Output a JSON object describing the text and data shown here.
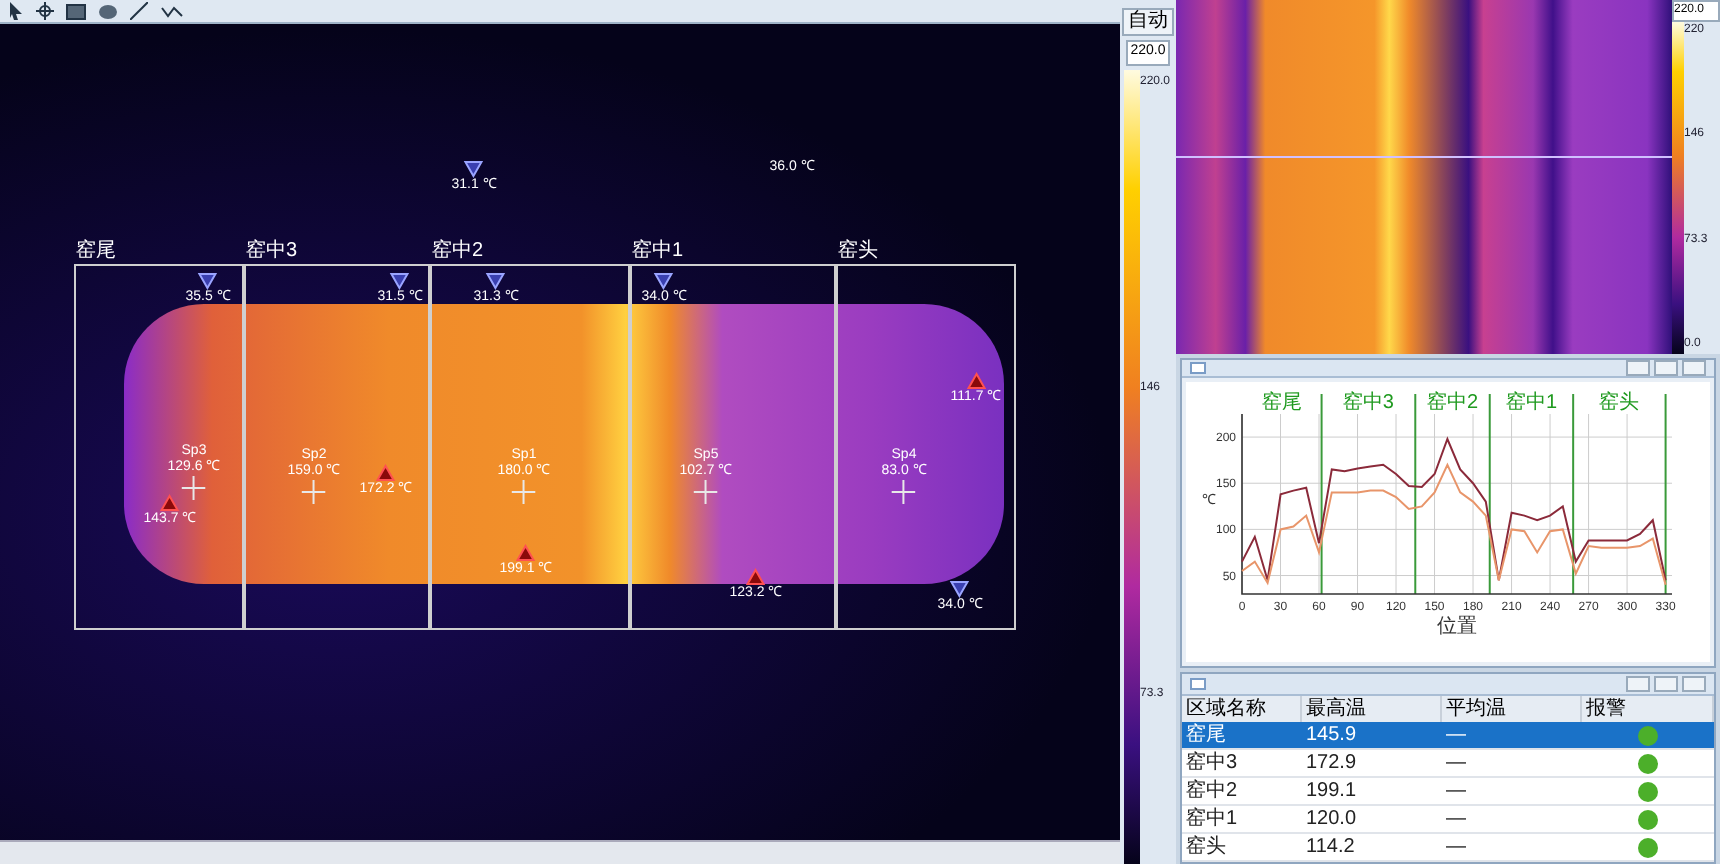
{
  "thermal_view": {
    "zones": [
      {
        "label": "窑尾"
      },
      {
        "label": "窑中3"
      },
      {
        "label": "窑中2"
      },
      {
        "label": "窑中1"
      },
      {
        "label": "窑头"
      }
    ],
    "markers": [
      {
        "kind": "min",
        "reading": "31.1 ℃"
      },
      {
        "kind": "text",
        "reading": "36.0 ℃"
      },
      {
        "kind": "min",
        "reading": "35.5 ℃"
      },
      {
        "kind": "min",
        "reading": "31.5 ℃"
      },
      {
        "kind": "min",
        "reading": "31.3 ℃"
      },
      {
        "kind": "min",
        "reading": "34.0 ℃"
      },
      {
        "kind": "spot",
        "name": "Sp3",
        "reading": "129.6 ℃"
      },
      {
        "kind": "max",
        "reading": "143.7 ℃"
      },
      {
        "kind": "spot",
        "name": "Sp2",
        "reading": "159.0 ℃"
      },
      {
        "kind": "max",
        "reading": "172.2 ℃"
      },
      {
        "kind": "spot",
        "name": "Sp1",
        "reading": "180.0 ℃"
      },
      {
        "kind": "max",
        "reading": "199.1 ℃"
      },
      {
        "kind": "spot",
        "name": "Sp5",
        "reading": "102.7 ℃"
      },
      {
        "kind": "max",
        "reading": "123.2 ℃"
      },
      {
        "kind": "spot",
        "name": "Sp4",
        "reading": "83.0 ℃"
      },
      {
        "kind": "max",
        "reading": "111.7 ℃"
      },
      {
        "kind": "min",
        "reading": "34.0 ℃"
      }
    ]
  },
  "palette_scale": {
    "mode_button": "自动",
    "range_max": "220.0",
    "ticks": [
      "220.0",
      "146",
      "73.3"
    ]
  },
  "strip_scale": {
    "range_max": "220.0",
    "ticks": [
      "220",
      "146",
      "73.3",
      "0.0"
    ]
  },
  "profile_chart": {
    "sections": [
      "窑尾",
      "窑中3",
      "窑中2",
      "窑中1",
      "窑头"
    ],
    "chart_data": {
      "type": "line",
      "grid": true,
      "xlabel": "位置",
      "ylabel": "℃",
      "x": [
        0,
        10,
        20,
        30,
        40,
        50,
        60,
        70,
        80,
        90,
        100,
        110,
        120,
        130,
        140,
        150,
        160,
        170,
        180,
        190,
        200,
        210,
        220,
        230,
        240,
        250,
        260,
        270,
        280,
        290,
        300,
        310,
        320,
        330
      ],
      "xlim": [
        0,
        335
      ],
      "ylim": [
        30,
        225
      ],
      "xticks": [
        0,
        30,
        60,
        90,
        120,
        150,
        180,
        210,
        240,
        270,
        300,
        330
      ],
      "yticks": [
        50,
        100,
        150,
        200
      ],
      "series": [
        {
          "color": "#8b2a3a",
          "values": [
            65,
            92,
            45,
            138,
            142,
            145,
            85,
            165,
            163,
            166,
            168,
            170,
            160,
            147,
            146,
            160,
            198,
            165,
            150,
            130,
            45,
            118,
            115,
            110,
            115,
            125,
            65,
            88,
            88,
            88,
            88,
            95,
            110,
            45
          ]
        },
        {
          "color": "#e8956a",
          "values": [
            55,
            65,
            42,
            100,
            103,
            115,
            75,
            140,
            140,
            140,
            142,
            142,
            135,
            122,
            125,
            140,
            170,
            140,
            130,
            115,
            45,
            100,
            98,
            75,
            98,
            100,
            52,
            82,
            80,
            80,
            80,
            82,
            90,
            40
          ]
        }
      ]
    }
  },
  "zone_table": {
    "columns": [
      "区域名称",
      "最高温",
      "平均温",
      "报警"
    ],
    "rows": [
      {
        "name": "窑尾",
        "max": "145.9",
        "avg": "—",
        "selected": true,
        "color": "#4caf2a"
      },
      {
        "name": "窑中3",
        "max": "172.9",
        "avg": "—",
        "selected": false,
        "color": "#4caf2a"
      },
      {
        "name": "窑中2",
        "max": "199.1",
        "avg": "—",
        "selected": false,
        "color": "#4caf2a"
      },
      {
        "name": "窑中1",
        "max": "120.0",
        "avg": "—",
        "selected": false,
        "color": "#4caf2a"
      },
      {
        "name": "窑头",
        "max": "114.2",
        "avg": "—",
        "selected": false,
        "color": "#4caf2a"
      }
    ]
  }
}
